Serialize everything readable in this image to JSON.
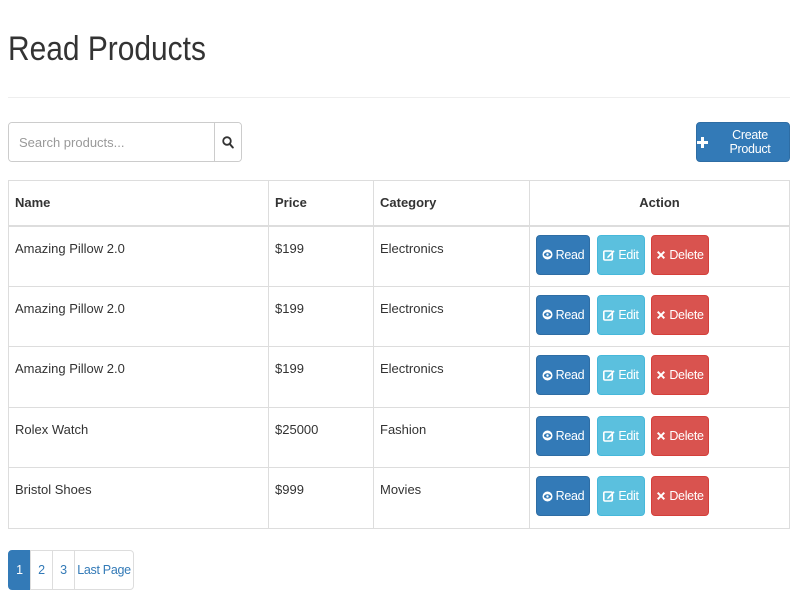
{
  "page": {
    "title": "Read Products"
  },
  "search": {
    "placeholder": "Search products..."
  },
  "toolbar": {
    "create_label": "Create Product"
  },
  "table": {
    "headers": {
      "name": "Name",
      "price": "Price",
      "category": "Category",
      "action": "Action"
    },
    "rows": [
      {
        "name": "Amazing Pillow 2.0",
        "price": "$199",
        "category": "Electronics"
      },
      {
        "name": "Amazing Pillow 2.0",
        "price": "$199",
        "category": "Electronics"
      },
      {
        "name": "Amazing Pillow 2.0",
        "price": "$199",
        "category": "Electronics"
      },
      {
        "name": "Rolex Watch",
        "price": "$25000",
        "category": "Fashion"
      },
      {
        "name": "Bristol Shoes",
        "price": "$999",
        "category": "Movies"
      }
    ],
    "actions": {
      "read": "Read",
      "edit": "Edit",
      "delete": "Delete"
    }
  },
  "pagination": {
    "pages": [
      "1",
      "2",
      "3"
    ],
    "last": "Last Page",
    "active": "1"
  },
  "colors": {
    "primary": "#337ab7",
    "info": "#5bc0de",
    "danger": "#d9534f"
  },
  "icons": {
    "search": "search-icon",
    "create": "plus-icon",
    "read": "eye-icon",
    "edit": "edit-icon",
    "delete": "close-icon"
  }
}
